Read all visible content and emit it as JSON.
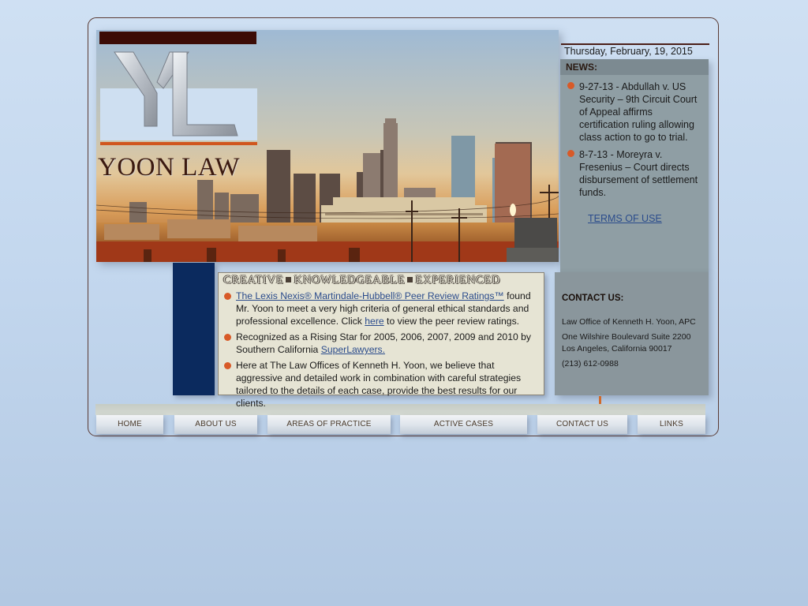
{
  "site": {
    "logo_text": "YOON LAW",
    "logo_monogram": "YL"
  },
  "header": {
    "date": "Thursday, February, 19, 2015"
  },
  "news": {
    "title": "NEWS:",
    "items": [
      {
        "text": "9-27-13 - Abdullah v. US Security – 9th Circuit Court of Appeal affirms certification ruling allowing class action to go to trial."
      },
      {
        "text": "8-7-13 - Moreyra v. Fresenius – Court directs disbursement of settlement funds."
      }
    ],
    "terms_link": "TERMS OF USE"
  },
  "contact": {
    "title": "CONTACT US:",
    "firm": "Law Office of Kenneth H. Yoon, APC",
    "address1": "One Wilshire Boulevard Suite 2200",
    "address2": "Los Angeles, California 90017",
    "phone": "(213) 612-0988"
  },
  "tagline": {
    "words": [
      "CREATIVE",
      "KNOWLEDGEABLE",
      "EXPERIENCED"
    ]
  },
  "content": {
    "item1_link": "The Lexis Nexis® Martindale-Hubbell® Peer Review Ratings™",
    "item1_rest": " found Mr. Yoon to meet a very high criteria of general ethical standards and professional excellence. Click ",
    "item1_here": "here",
    "item1_end": " to view the peer review ratings.",
    "item2_text": "Recognized as a Rising Star for 2005, 2006, 2007, 2009 and 2010 by Southern California ",
    "item2_link": "SuperLawyers.",
    "item3_text": "Here at The Law Offices of Kenneth H. Yoon, we believe that aggressive and detailed work in combination with careful strategies tailored to the details of each case, provide the best results for our clients."
  },
  "nav": {
    "items": [
      "HOME",
      "ABOUT US",
      "AREAS OF PRACTICE",
      "ACTIVE CASES",
      "CONTACT US",
      "LINKS"
    ]
  },
  "colors": {
    "accent": "#d85a28",
    "dark_brown": "#3c0c06",
    "navy": "#0b2a5e",
    "link": "#2b4c8c"
  }
}
